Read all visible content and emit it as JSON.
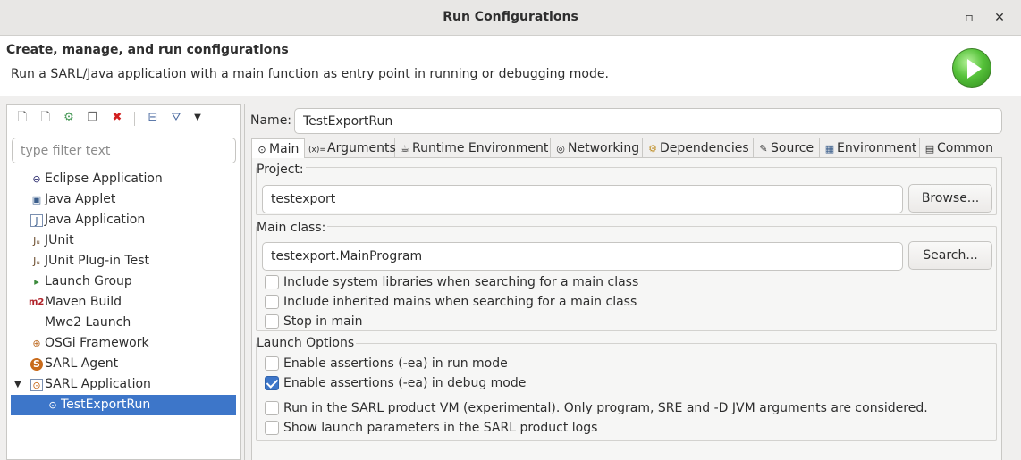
{
  "window": {
    "title": "Run Configurations",
    "minimize_glyph": "▫",
    "close_glyph": "✕"
  },
  "header": {
    "title": "Create, manage, and run configurations",
    "description": "Run a SARL/Java application with a main function as entry point in running or debugging mode."
  },
  "left": {
    "toolbar": [
      {
        "name": "new-config-icon",
        "glyph": "🗋"
      },
      {
        "name": "new-prototype-icon",
        "glyph": "🗋"
      },
      {
        "name": "export-config-icon",
        "glyph": "⚙"
      },
      {
        "name": "duplicate-config-icon",
        "glyph": "❐"
      },
      {
        "name": "delete-config-icon",
        "glyph": "✖"
      },
      {
        "name": "collapse-all-icon",
        "glyph": "⊟"
      },
      {
        "name": "filter-icon",
        "glyph": "⛛"
      },
      {
        "name": "view-menu-icon",
        "glyph": "▼"
      }
    ],
    "filter_placeholder": "type filter text",
    "tree": [
      {
        "label": "Eclipse Application",
        "icon": "eclipse-icon",
        "glyph": "⊖"
      },
      {
        "label": "Java Applet",
        "icon": "java-applet-icon",
        "glyph": "▣"
      },
      {
        "label": "Java Application",
        "icon": "java-application-icon",
        "glyph": "J"
      },
      {
        "label": "JUnit",
        "icon": "junit-icon",
        "glyph": "Jᵤ"
      },
      {
        "label": "JUnit Plug-in Test",
        "icon": "junit-plugin-icon",
        "glyph": "Jᵤ"
      },
      {
        "label": "Launch Group",
        "icon": "launch-group-icon",
        "glyph": "▸"
      },
      {
        "label": "Maven Build",
        "icon": "maven-icon",
        "glyph": "m2"
      },
      {
        "label": "Mwe2 Launch",
        "icon": "",
        "glyph": ""
      },
      {
        "label": "OSGi Framework",
        "icon": "osgi-icon",
        "glyph": "⊕"
      },
      {
        "label": "SARL Agent",
        "icon": "sarl-agent-icon",
        "glyph": "S"
      },
      {
        "label": "SARL Application",
        "icon": "sarl-application-icon",
        "glyph": "⊙"
      },
      {
        "label": "TestExportRun",
        "icon": "test-export-run-icon",
        "glyph": "⊙"
      }
    ],
    "twisty_glyph": "▼"
  },
  "right": {
    "name_label": "Name:",
    "name_value": "TestExportRun",
    "tabs": [
      {
        "label": "Main",
        "icon": "main-tab-icon",
        "glyph": "⊙"
      },
      {
        "label": "Arguments",
        "icon": "arguments-tab-icon",
        "glyph": "(x)="
      },
      {
        "label": "Runtime Environment",
        "icon": "runtime-tab-icon",
        "glyph": "☕"
      },
      {
        "label": "Networking",
        "icon": "networking-tab-icon",
        "glyph": "◎"
      },
      {
        "label": "Dependencies",
        "icon": "dependencies-tab-icon",
        "glyph": "⚙"
      },
      {
        "label": "Source",
        "icon": "source-tab-icon",
        "glyph": "✎"
      },
      {
        "label": "Environment",
        "icon": "environment-tab-icon",
        "glyph": "▦"
      },
      {
        "label": "Common",
        "icon": "common-tab-icon",
        "glyph": "▤"
      }
    ],
    "project": {
      "label": "Project:",
      "value": "testexport",
      "button": "Browse..."
    },
    "main_class": {
      "label": "Main class:",
      "value": "testexport.MainProgram",
      "button": "Search...",
      "options": [
        {
          "label": "Include system libraries when searching for a main class",
          "checked": false
        },
        {
          "label": "Include inherited mains when searching for a main class",
          "checked": false
        },
        {
          "label": "Stop in main",
          "checked": false
        }
      ]
    },
    "launch_options": {
      "label": "Launch Options",
      "options": [
        {
          "label": "Enable assertions (-ea) in run mode",
          "checked": false
        },
        {
          "label": "Enable assertions (-ea) in debug mode",
          "checked": true
        },
        {
          "label": "Run in the SARL product VM (experimental). Only program, SRE and -D JVM arguments are considered.",
          "checked": false
        },
        {
          "label": "Show launch parameters in the SARL product logs",
          "checked": false
        }
      ]
    }
  }
}
